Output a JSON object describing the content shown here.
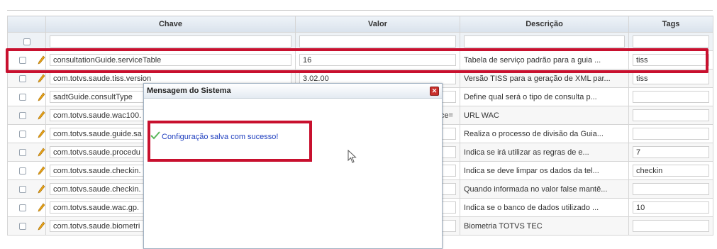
{
  "columns": {
    "key": "Chave",
    "value": "Valor",
    "description": "Descrição",
    "tags": "Tags"
  },
  "rows": [
    {
      "key": "consultationGuide.serviceTable",
      "value": "16",
      "description": "Tabela de serviço padrão para a guia ...",
      "tags": "tiss"
    },
    {
      "key": "com.totvs.saude.tiss.version",
      "value": "3.02.00",
      "description": "Versão TISS para a geração de XML par...",
      "tags": "tiss"
    },
    {
      "key": "sadtGuide.consultType",
      "value": "",
      "description": "Define qual será o tipo de consulta p...",
      "tags": ""
    },
    {
      "key": "com.totvs.saude.wac100.",
      "value": "vice=",
      "description": "URL WAC",
      "tags": ""
    },
    {
      "key": "com.totvs.saude.guide.sa",
      "value": "",
      "description": "Realiza o processo de divisão da Guia...",
      "tags": ""
    },
    {
      "key": "com.totvs.saude.procedu",
      "value": "",
      "description": "Indica se irá utilizar as regras de e...",
      "tags": "7"
    },
    {
      "key": "com.totvs.saude.checkin.",
      "value": "",
      "description": "Indica se deve limpar os dados da tel...",
      "tags": "checkin"
    },
    {
      "key": "com.totvs.saude.checkin.",
      "value": "",
      "description": "Quando informada no valor false mantê...",
      "tags": ""
    },
    {
      "key": "com.totvs.saude.wac.gp.",
      "value": "",
      "description": "Indica se o banco de dados utilizado ...",
      "tags": "10"
    },
    {
      "key": "com.totvs.saude.biometri",
      "value": "",
      "description": "Biometria TOTVS TEC",
      "tags": ""
    }
  ],
  "dialog": {
    "title": "Mensagem do Sistema",
    "message": "Configuração salva com sucesso!"
  },
  "colors": {
    "highlight": "#c8102e",
    "message": "#1f3fbf",
    "check": "#5cb85c",
    "pencil": "#e8a317"
  }
}
